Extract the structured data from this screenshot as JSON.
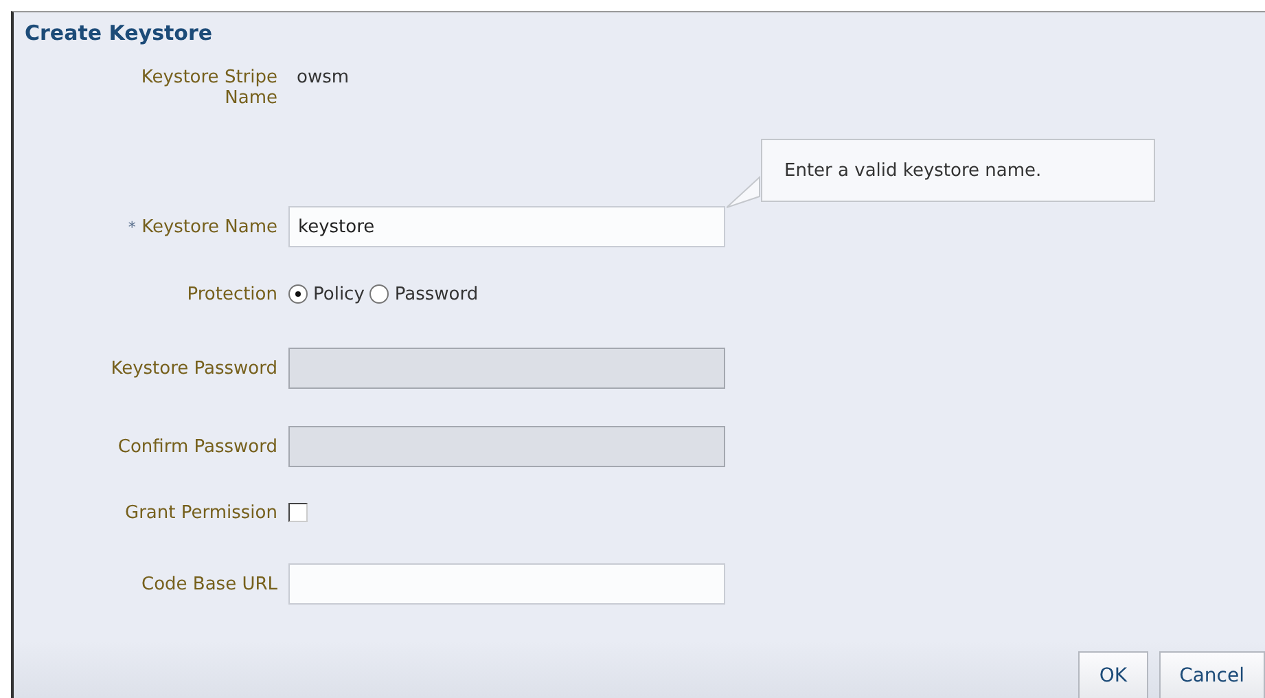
{
  "dialog": {
    "title": "Create Keystore"
  },
  "fields": [
    {
      "kind": "text",
      "label": "Keystore Stripe Name",
      "value": "owsm"
    },
    {
      "kind": "input",
      "label": "Keystore Name",
      "required": true,
      "value": "keystore",
      "disabled": false
    },
    {
      "kind": "radio",
      "label": "Protection",
      "options": [
        {
          "label": "Policy",
          "selected": true
        },
        {
          "label": "Password",
          "selected": false
        }
      ]
    },
    {
      "kind": "input",
      "label": "Keystore Password",
      "required": false,
      "disabled": true
    },
    {
      "kind": "input",
      "label": "Confirm Password",
      "required": false,
      "disabled": true
    },
    {
      "kind": "checkbox",
      "label": "Grant Permission",
      "checked": false
    },
    {
      "kind": "input",
      "label": "Code Base URL",
      "required": false,
      "disabled": false
    }
  ],
  "tooltip": {
    "text": "Enter a valid keystore name."
  },
  "required_mark": "*",
  "buttons": [
    "OK",
    "Cancel"
  ]
}
